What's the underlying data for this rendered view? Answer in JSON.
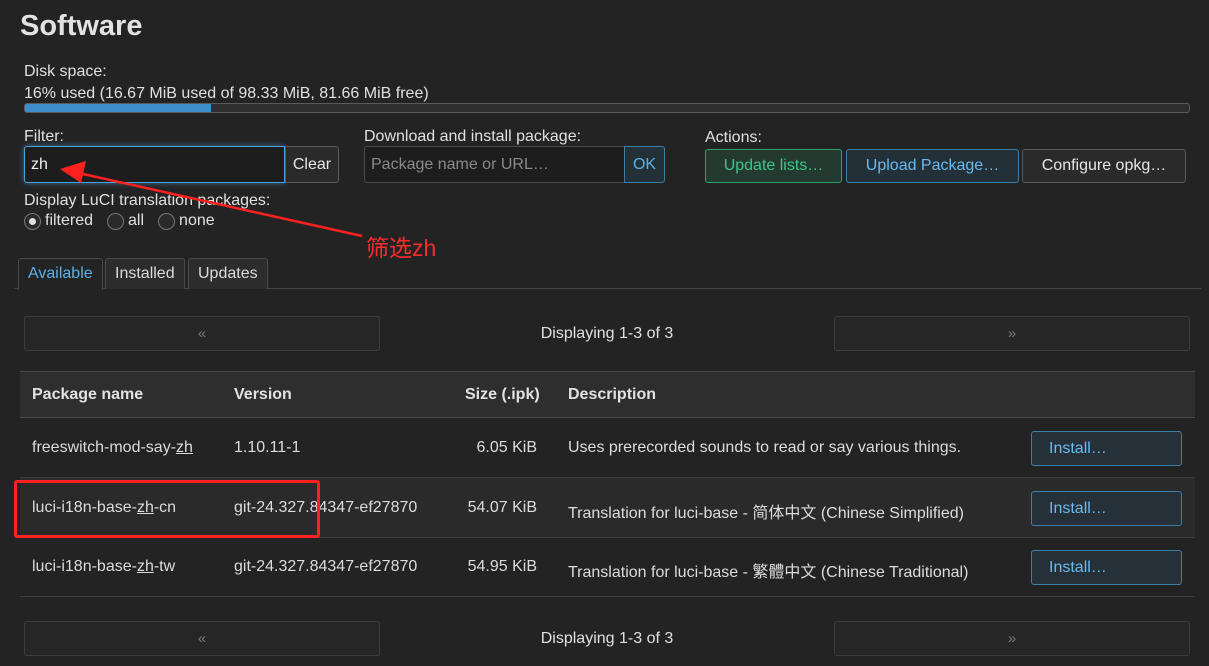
{
  "page": {
    "title": "Software"
  },
  "disk": {
    "label": "Disk space:",
    "usage_text": "16% used (16.67 MiB used of 98.33 MiB, 81.66 MiB free)",
    "used_fraction": 0.16
  },
  "filter": {
    "label": "Filter:",
    "value": "zh",
    "clear_label": "Clear"
  },
  "download": {
    "label": "Download and install package:",
    "placeholder": "Package name or URL…",
    "ok_label": "OK"
  },
  "actions": {
    "label": "Actions:",
    "update_lists": "Update lists…",
    "upload_package": "Upload Package…",
    "configure_opkg": "Configure opkg…"
  },
  "translation": {
    "label": "Display LuCI translation packages:",
    "options": [
      {
        "label": "filtered",
        "selected": true
      },
      {
        "label": "all",
        "selected": false
      },
      {
        "label": "none",
        "selected": false
      }
    ]
  },
  "annotation": {
    "text": "筛选zh",
    "color": "#ff2b2b"
  },
  "tabs": [
    {
      "label": "Available"
    },
    {
      "label": "Installed"
    },
    {
      "label": "Updates"
    }
  ],
  "pager": {
    "prev": "«",
    "next": "»",
    "status": "Displaying 1-3 of 3"
  },
  "table": {
    "headers": {
      "name": "Package name",
      "version": "Version",
      "size": "Size (.ipk)",
      "description": "Description"
    },
    "rows": [
      {
        "name_prefix": "freeswitch-mod-say-",
        "name_match": "zh",
        "name_suffix": "",
        "version": "1.10.11-1",
        "size": "6.05 KiB",
        "description": "Uses prerecorded sounds to read or say various things.",
        "action": "Install…"
      },
      {
        "name_prefix": "luci-i18n-base-",
        "name_match": "zh",
        "name_suffix": "-cn",
        "version": "git-24.327.84347-ef27870",
        "size": "54.07 KiB",
        "description": "Translation for luci-base - 简体中文 (Chinese Simplified)",
        "action": "Install…"
      },
      {
        "name_prefix": "luci-i18n-base-",
        "name_match": "zh",
        "name_suffix": "-tw",
        "version": "git-24.327.84347-ef27870",
        "size": "54.95 KiB",
        "description": "Translation for luci-base - 繁體中文 (Chinese Traditional)",
        "action": "Install…"
      }
    ]
  }
}
